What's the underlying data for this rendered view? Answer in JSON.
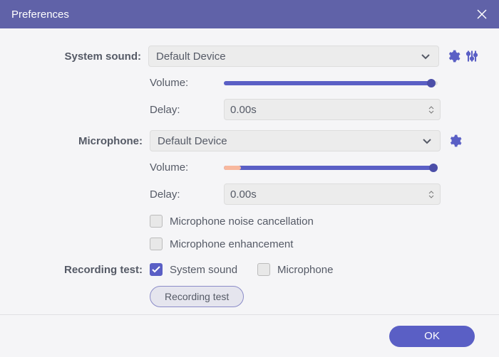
{
  "title": "Preferences",
  "system_sound": {
    "label": "System sound:",
    "device": "Default Device",
    "volume_label": "Volume:",
    "volume_percent": 97,
    "delay_label": "Delay:",
    "delay_value": "0.00s"
  },
  "microphone": {
    "label": "Microphone:",
    "device": "Default Device",
    "volume_label": "Volume:",
    "volume_percent": 98,
    "low_fill_percent": 8,
    "delay_label": "Delay:",
    "delay_value": "0.00s",
    "noise_cancellation_label": "Microphone noise cancellation",
    "noise_cancellation_checked": false,
    "enhancement_label": "Microphone enhancement",
    "enhancement_checked": false
  },
  "recording_test": {
    "label": "Recording test:",
    "system_sound_label": "System sound",
    "system_sound_checked": true,
    "microphone_label": "Microphone",
    "microphone_checked": false,
    "button_label": "Recording test"
  },
  "footer": {
    "ok_label": "OK"
  }
}
